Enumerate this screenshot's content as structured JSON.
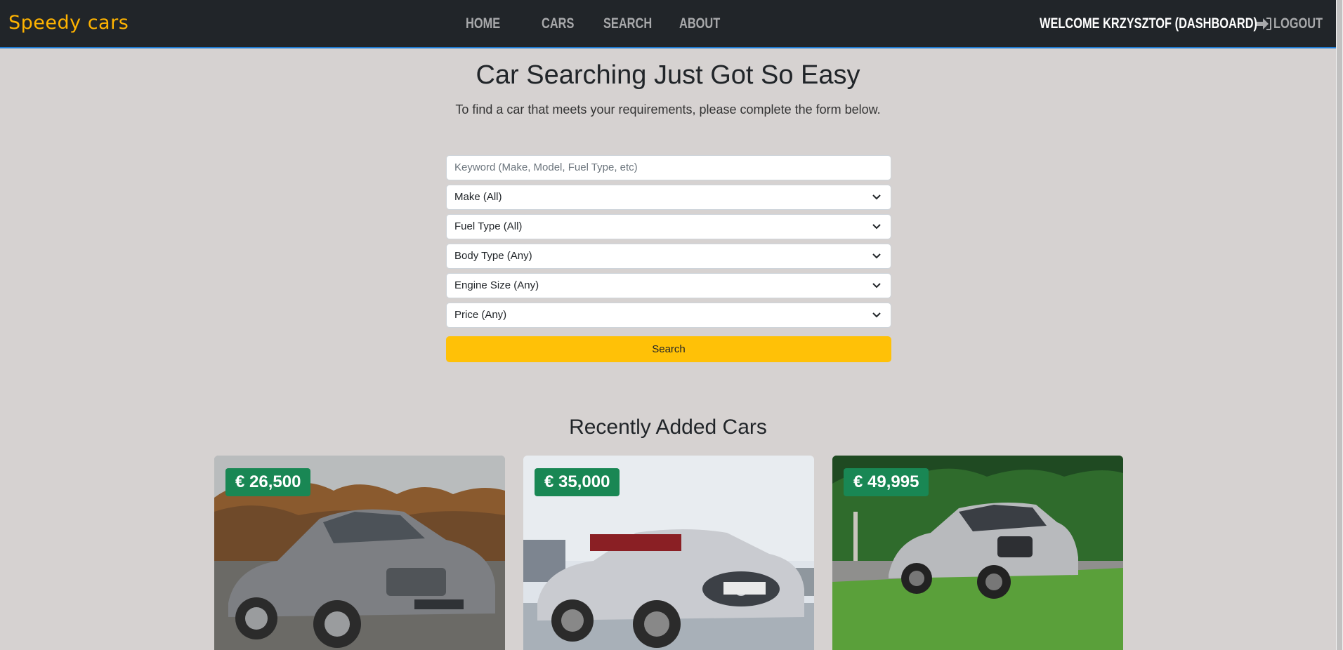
{
  "brand": "Speedy cars",
  "nav": {
    "items": [
      "HOME",
      "CARS",
      "SEARCH",
      "ABOUT"
    ]
  },
  "user": {
    "welcome": "WELCOME KRZYSZTOF (DASHBOARD)",
    "logout": "LOGOUT"
  },
  "hero": {
    "title": "Car Searching Just Got So Easy",
    "subtitle": "To find a car that meets your requirements, please complete the form below."
  },
  "search_form": {
    "keyword_placeholder": "Keyword (Make, Model, Fuel Type, etc)",
    "make": "Make (All)",
    "fuel_type": "Fuel Type (All)",
    "body_type": "Body Type (Any)",
    "engine_size": "Engine Size (Any)",
    "price": "Price (Any)",
    "search_label": "Search"
  },
  "recent": {
    "title": "Recently Added Cars",
    "cars": [
      {
        "price": "€ 26,500",
        "color": "#7d7f83",
        "bg": "autumn"
      },
      {
        "price": "€ 35,000",
        "color": "#c9cbd0",
        "bg": "sky"
      },
      {
        "price": "€ 49,995",
        "color": "#b8babd",
        "bg": "forest"
      }
    ]
  },
  "colors": {
    "brand": "#ffb300",
    "navbar": "#212529",
    "accent": "#ffc107",
    "price_badge": "#198754"
  }
}
